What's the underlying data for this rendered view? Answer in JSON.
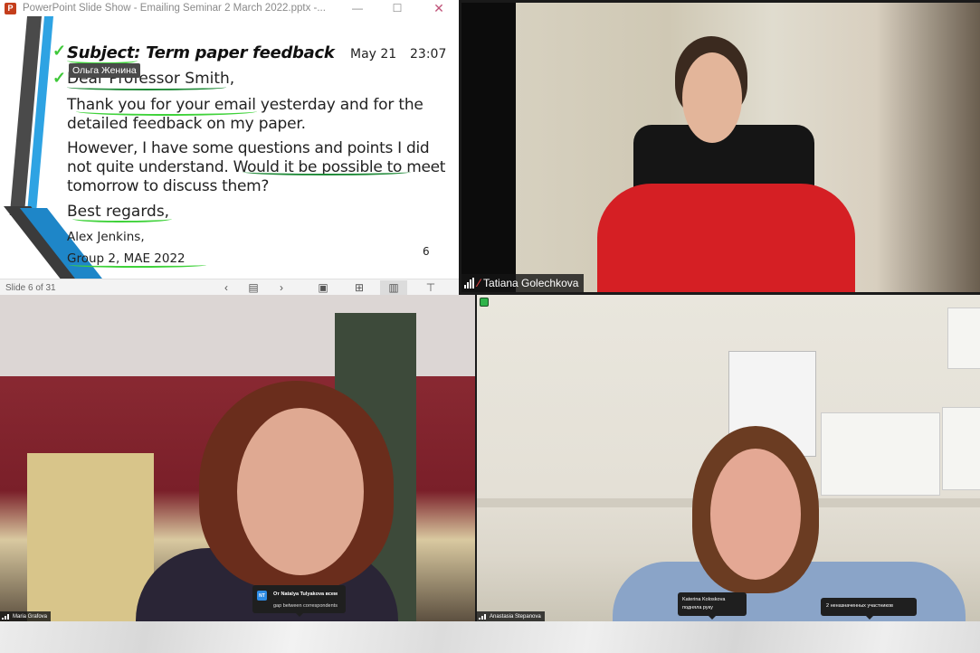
{
  "powerpoint": {
    "window_title": "PowerPoint Slide Show  -  Emailing Seminar 2 March 2022.pptx -...",
    "logo_letter": "P",
    "window_buttons": {
      "minimize": "—",
      "maximize": "☐",
      "close": "✕"
    },
    "annotation_tooltip": "Ольга Женина",
    "slide": {
      "subject": "Subject: Term paper feedback",
      "date": "May 21",
      "time": "23:07",
      "greeting": "Dear Professor Smith,",
      "paragraph1": "Thank you for your email yesterday and for the detailed feedback on my paper.",
      "paragraph2": "However, I have some questions and points I did not quite understand. Would it be possible to meet tomorrow to discuss them?",
      "closing": "Best regards,",
      "signature_name": "Alex Jenkins,",
      "signature_group": "Group 2, MAE 2022",
      "page_number": "6"
    },
    "status_bar": {
      "slide_indicator": "Slide 6 of 31",
      "nav_buttons": [
        {
          "name": "previous-slide",
          "glyph": "‹"
        },
        {
          "name": "slide-list",
          "glyph": "▤"
        },
        {
          "name": "next-slide",
          "glyph": "›"
        },
        {
          "name": "normal-view",
          "glyph": "▣"
        },
        {
          "name": "slide-sorter",
          "glyph": "⊞"
        },
        {
          "name": "reading-view",
          "glyph": "▥"
        },
        {
          "name": "slide-show",
          "glyph": "⊤"
        }
      ]
    }
  },
  "participants": [
    {
      "name": "Tatiana Golechkova",
      "muted": true
    },
    {
      "name": "Maria Grafova",
      "muted": false
    },
    {
      "name": "Anastasia Stepanova",
      "muted": false
    }
  ],
  "chat_notification": {
    "avatar_initials": "NT",
    "from": "От Natalya Tulyakova всем",
    "message": "gap between correspondents"
  },
  "hand_raise_notification": {
    "name": "Katerina Koloskova",
    "text": "подняла руку"
  },
  "unnamed_notification": {
    "text": "2 неназначенных участников"
  },
  "icons": {
    "mic_off": "🎙",
    "check": "✓"
  }
}
